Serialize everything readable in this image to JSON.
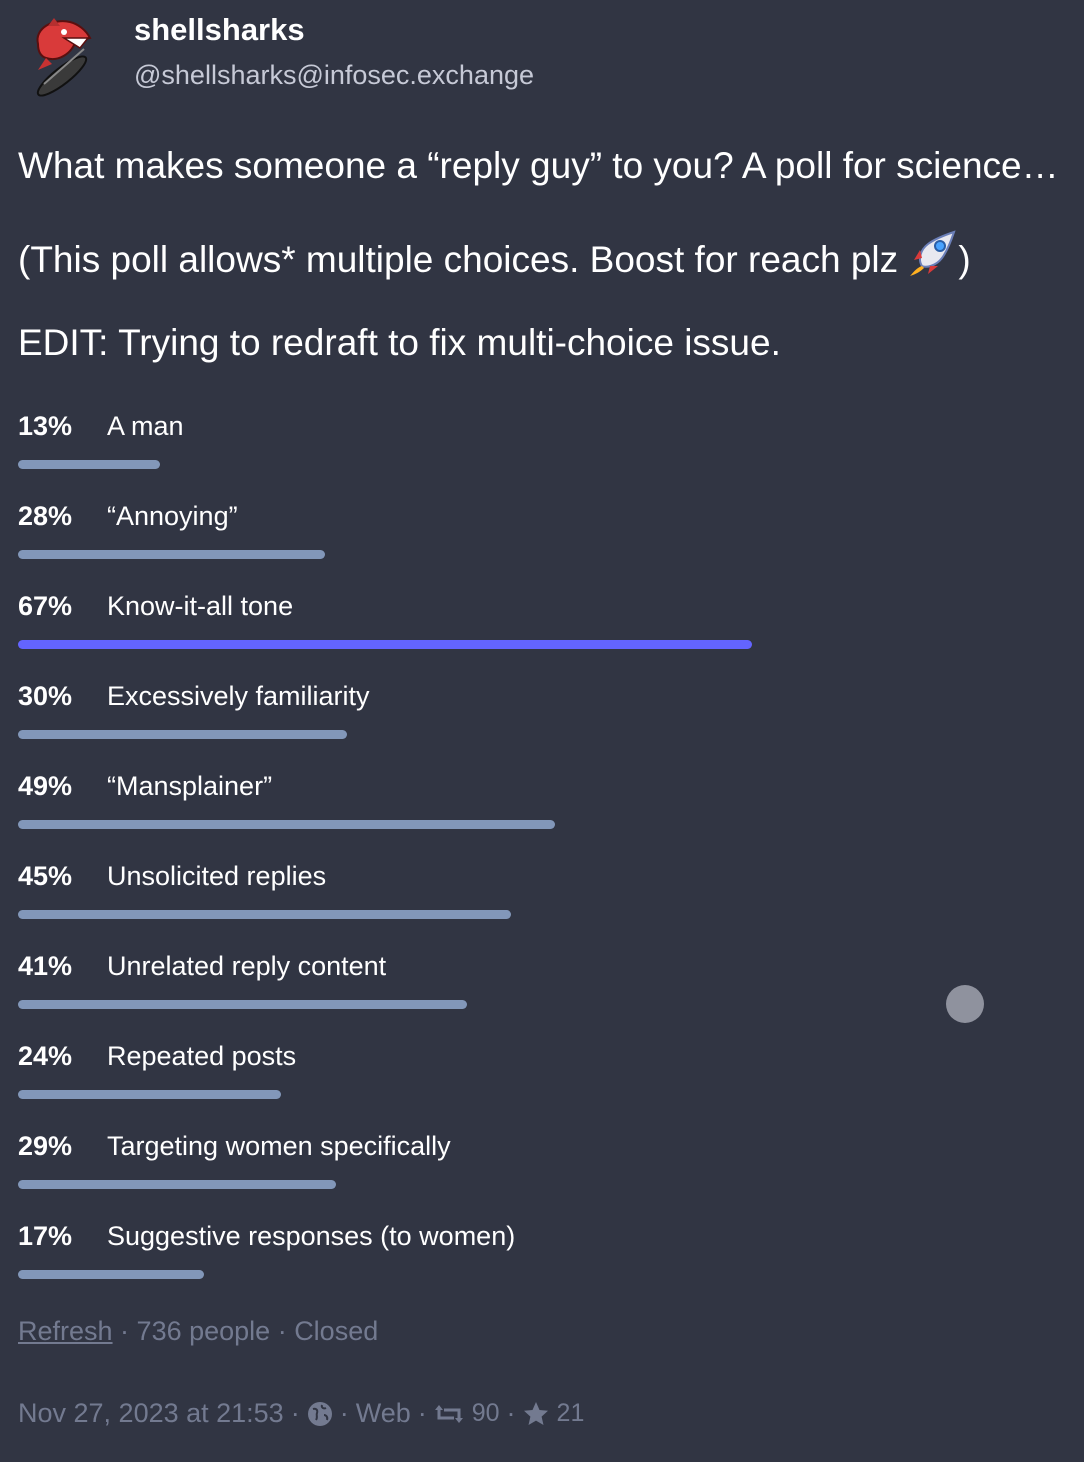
{
  "author": {
    "display_name": "shellsharks",
    "handle": "@shellsharks@infosec.exchange",
    "avatar": "shark-surfboard-avatar"
  },
  "post": {
    "line1": "What makes someone a “reply guy” to you? A poll for science…",
    "line2": "(This poll allows* multiple choices. Boost for reach plz ",
    "line2_emoji": "rocket-emoji",
    "line2_end": ")",
    "line3": "EDIT: Trying to redraft to fix multi-choice issue."
  },
  "poll": {
    "options": [
      {
        "percent_label": "13%",
        "percent": 13,
        "label": "A man"
      },
      {
        "percent_label": "28%",
        "percent": 28,
        "label": "“Annoying”"
      },
      {
        "percent_label": "67%",
        "percent": 67,
        "label": "Know-it-all tone",
        "leading": true
      },
      {
        "percent_label": "30%",
        "percent": 30,
        "label": "Excessively familiarity"
      },
      {
        "percent_label": "49%",
        "percent": 49,
        "label": "“Mansplainer”"
      },
      {
        "percent_label": "45%",
        "percent": 45,
        "label": "Unsolicited replies"
      },
      {
        "percent_label": "41%",
        "percent": 41,
        "label": "Unrelated reply content"
      },
      {
        "percent_label": "24%",
        "percent": 24,
        "label": "Repeated posts"
      },
      {
        "percent_label": "29%",
        "percent": 29,
        "label": "Targeting women specifically"
      },
      {
        "percent_label": "17%",
        "percent": 17,
        "label": "Suggestive responses (to women)"
      }
    ],
    "refresh_label": "Refresh",
    "voters": "736 people",
    "status": "Closed",
    "leading_color": "#6364ff",
    "bar_color": "#8297b9"
  },
  "meta": {
    "timestamp": "Nov 27, 2023 at 21:53",
    "visibility_icon": "globe-icon",
    "application": "Web",
    "boost_icon": "boost-icon",
    "boosts": "90",
    "favourite_icon": "star-icon",
    "favourites": "21"
  },
  "colors": {
    "background": "#313543",
    "muted_text": "#737a90"
  }
}
